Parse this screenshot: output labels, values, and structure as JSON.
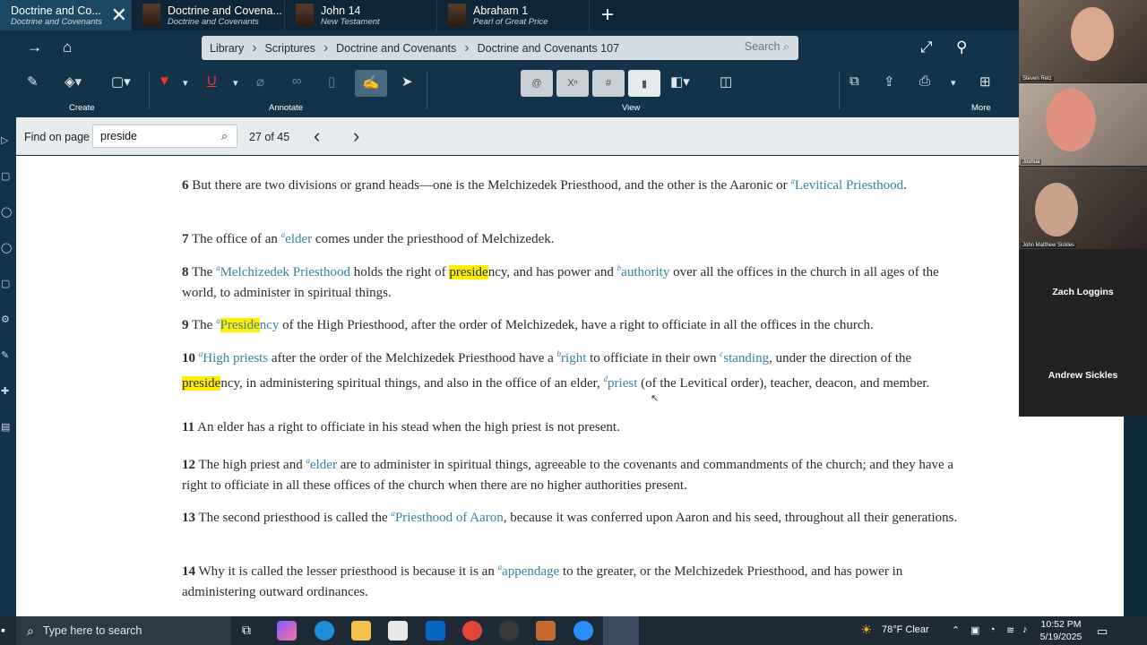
{
  "tabs": [
    {
      "title": "Doctrine and Co...",
      "subtitle": "Doctrine and Covenants",
      "active": true
    },
    {
      "title": "Doctrine and Covena...",
      "subtitle": "Doctrine and Covenants",
      "active": false
    },
    {
      "title": "John 14",
      "subtitle": "New Testament",
      "active": false
    },
    {
      "title": "Abraham 1",
      "subtitle": "Pearl of Great Price",
      "active": false
    }
  ],
  "breadcrumb": [
    "Library",
    "Scriptures",
    "Doctrine and Covenants",
    "Doctrine and Covenants 107"
  ],
  "search_placeholder": "Search",
  "toolbar": {
    "create": "Create",
    "annotate": "Annotate",
    "view": "View",
    "more": "More"
  },
  "find": {
    "label": "Find on page",
    "query": "preside",
    "count": "27 of 45"
  },
  "verses": {
    "v6": {
      "num": "6",
      "a": "But there are two divisions or grand heads—one is the Melchizedek Priesthood, and the other is the Aaronic or ",
      "s": "a",
      "l": "Levitical Priesthood",
      "b": "."
    },
    "v7": {
      "num": "7",
      "a": "The office of an ",
      "s": "a",
      "l": "elder",
      "b": " comes under the priesthood of Melchizedek."
    },
    "v8": {
      "num": "8",
      "a": "The ",
      "s1": "a",
      "l1": "Melchizedek Priesthood",
      "b": " holds the right of ",
      "h": "preside",
      "c": "ncy, and has power and ",
      "s2": "b",
      "l2": "authority",
      "d": " over all the offices in the church in all ages of the world, to administer in spiritual things."
    },
    "v9": {
      "num": "9",
      "a": "The ",
      "s": "a",
      "h": "Preside",
      "l": "ncy",
      "b": " of the High Priesthood, after the order of Melchizedek, have a right to officiate in all the offices in the church."
    },
    "v10": {
      "num": "10",
      "s1": "a",
      "l1": "High priests",
      "a": " after the order of the Melchizedek Priesthood have a ",
      "s2": "b",
      "l2": "right",
      "b": " to officiate in their own ",
      "s3": "c",
      "l3": "standing",
      "c": ", under the direction of the ",
      "h": "preside",
      "d": "ncy, in administering spiritual things, and also in the office of an elder, ",
      "s4": "d",
      "l4": "priest",
      "e": " (of the Levitical order), teacher, deacon, and member."
    },
    "v11": {
      "num": "11",
      "a": "An elder has a right to officiate in his stead when the high priest is not present."
    },
    "v12": {
      "num": "12",
      "a": "The high priest and ",
      "s": "a",
      "l": "elder",
      "b": " are to administer in spiritual things, agreeable to the covenants and commandments of the church; and they have a right to officiate in all these offices of the church when there are no higher authorities present."
    },
    "v13": {
      "num": "13",
      "a": "The second priesthood is called the ",
      "s": "a",
      "l": "Priesthood of Aaron",
      "b": ", because it was conferred upon Aaron and his seed, throughout all their generations."
    },
    "v14": {
      "num": "14",
      "a": "Why it is called the lesser priesthood is because it is an ",
      "s": "a",
      "l": "appendage",
      "b": " to the greater, or the Melchizedek Priesthood, and has power in administering outward ordinances."
    }
  },
  "participants": {
    "p1": "Steven Retz",
    "p2": "Joshua",
    "p3": "John Matthew Sickles",
    "p4": "Zach Loggins",
    "p5": "Andrew Sickles"
  },
  "taskbar": {
    "search_placeholder": "Type here to search",
    "weather": "78°F  Clear",
    "time": "10:52 PM",
    "date": "5/19/2025"
  }
}
